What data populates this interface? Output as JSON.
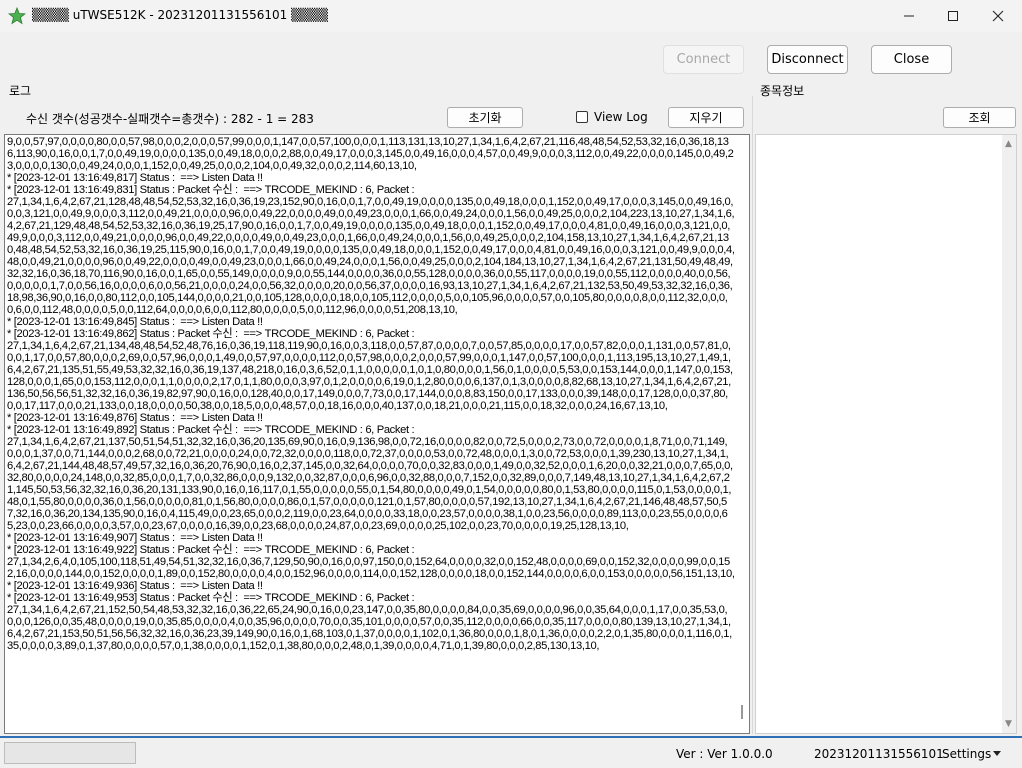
{
  "window": {
    "title": "▒▒▒▒ uTWSE512K - 20231201131556101 ▒▒▒▒",
    "minimize_icon": "minimize-icon",
    "maximize_icon": "maximize-icon",
    "close_icon": "close-icon"
  },
  "toolbar": {
    "connect_label": "Connect",
    "disconnect_label": "Disconnect",
    "close_label": "Close"
  },
  "log_panel": {
    "label": "로그",
    "count_text": "수신 갯수(성공갯수-실패갯수=총갯수) :   282 - 1 = 283",
    "reset_label": "초기화",
    "view_log_label": "View Log",
    "clear_label": "지우기",
    "content": "9,0,0,57,97,0,0,0,0,80,0,0,57,98,0,0,0,2,0,0,0,57,99,0,0,0,1,147,0,0,57,100,0,0,0,1,113,131,13,10,27,1,34,1,6,4,2,67,21,116,48,48,54,52,53,32,16,0,36,18,136,113,90,0,16,0,0,1,7,0,0,49,19,0,0,0,0,135,0,0,49,18,0,0,0,2,88,0,0,49,17,0,0,0,3,145,0,0,49,16,0,0,0,4,57,0,0,49,9,0,0,0,3,112,0,0,49,22,0,0,0,0,145,0,0,49,23,0,0,0,0,130,0,0,49,24,0,0,0,1,152,0,0,49,25,0,0,0,2,104,0,0,49,32,0,0,0,2,114,60,13,10,\n* [2023-12-01 13:16:49,817] Status :  ==> Listen Data !!\n* [2023-12-01 13:16:49,831] Status : Packet 수신 :  ==> TRCODE_MEKIND : 6, Packet :\n27,1,34,1,6,4,2,67,21,128,48,48,54,52,53,32,16,0,36,19,23,152,90,0,16,0,0,1,7,0,0,49,19,0,0,0,0,135,0,0,49,18,0,0,0,1,152,0,0,49,17,0,0,0,3,145,0,0,49,16,0,0,0,3,121,0,0,49,9,0,0,0,3,112,0,0,49,21,0,0,0,0,96,0,0,49,22,0,0,0,0,49,0,0,49,23,0,0,0,1,66,0,0,49,24,0,0,0,1,56,0,0,49,25,0,0,0,2,104,223,13,10,27,1,34,1,6,4,2,67,21,129,48,48,54,52,53,32,16,0,36,19,25,17,90,0,16,0,0,1,7,0,0,49,19,0,0,0,0,135,0,0,49,18,0,0,0,1,152,0,0,49,17,0,0,0,4,81,0,0,49,16,0,0,0,3,121,0,0,49,9,0,0,0,3,112,0,0,49,21,0,0,0,0,96,0,0,49,22,0,0,0,0,49,0,0,49,23,0,0,0,1,66,0,0,49,24,0,0,0,1,56,0,0,49,25,0,0,0,2,104,158,13,10,27,1,34,1,6,4,2,67,21,130,48,48,54,52,53,32,16,0,36,19,25,115,90,0,16,0,0,1,7,0,0,49,19,0,0,0,0,135,0,0,49,18,0,0,0,1,152,0,0,49,17,0,0,0,4,81,0,0,49,16,0,0,0,3,121,0,0,49,9,0,0,0,4,48,0,0,49,21,0,0,0,0,96,0,0,49,22,0,0,0,0,49,0,0,49,23,0,0,0,1,66,0,0,49,24,0,0,0,1,56,0,0,49,25,0,0,0,2,104,184,13,10,27,1,34,1,6,4,2,67,21,131,50,49,48,49,32,32,16,0,36,18,70,116,90,0,16,0,0,1,65,0,0,55,149,0,0,0,0,9,0,0,55,144,0,0,0,0,36,0,0,55,128,0,0,0,0,36,0,0,55,117,0,0,0,0,19,0,0,55,112,0,0,0,0,40,0,0,56,0,0,0,0,0,1,7,0,0,56,16,0,0,0,0,6,0,0,56,21,0,0,0,0,24,0,0,56,32,0,0,0,0,20,0,0,56,37,0,0,0,0,16,93,13,10,27,1,34,1,6,4,2,67,21,132,53,50,49,53,32,32,16,0,36,18,98,36,90,0,16,0,0,80,112,0,0,105,144,0,0,0,0,21,0,0,105,128,0,0,0,0,18,0,0,105,112,0,0,0,0,5,0,0,105,96,0,0,0,0,57,0,0,105,80,0,0,0,0,8,0,0,112,32,0,0,0,0,6,0,0,112,48,0,0,0,0,5,0,0,112,64,0,0,0,0,6,0,0,112,80,0,0,0,0,5,0,0,112,96,0,0,0,0,51,208,13,10,\n* [2023-12-01 13:16:49,845] Status :  ==> Listen Data !!\n* [2023-12-01 13:16:49,862] Status : Packet 수신 :  ==> TRCODE_MEKIND : 6, Packet :\n27,1,34,1,6,4,2,67,21,134,48,48,54,52,48,76,16,0,36,19,118,119,90,0,16,0,0,3,118,0,0,57,87,0,0,0,0,7,0,0,57,85,0,0,0,0,17,0,0,57,82,0,0,0,1,131,0,0,57,81,0,0,0,1,17,0,0,57,80,0,0,0,2,69,0,0,57,96,0,0,0,1,49,0,0,57,97,0,0,0,0,112,0,0,57,98,0,0,0,2,0,0,0,57,99,0,0,0,1,147,0,0,57,100,0,0,0,1,113,195,13,10,27,1,49,1,6,4,2,67,21,135,51,55,49,53,32,32,16,0,36,19,137,48,218,0,16,0,3,6,52,0,1,1,0,0,0,0,0,1,0,1,0,80,0,0,0,1,56,0,1,0,0,0,0,5,53,0,0,153,144,0,0,0,1,147,0,0,153,128,0,0,0,1,65,0,0,153,112,0,0,0,1,1,0,0,0,0,2,17,0,1,1,80,0,0,0,3,97,0,1,2,0,0,0,0,6,19,0,1,2,80,0,0,0,6,137,0,1,3,0,0,0,0,8,82,68,13,10,27,1,34,1,6,4,2,67,21,136,50,56,56,51,32,32,16,0,36,19,82,97,90,0,16,0,0,128,40,0,0,17,149,0,0,0,7,73,0,0,17,144,0,0,0,8,83,150,0,0,17,133,0,0,0,39,148,0,0,17,128,0,0,0,37,80,0,0,17,117,0,0,0,21,133,0,0,18,0,0,0,0,50,38,0,0,18,5,0,0,0,48,57,0,0,18,16,0,0,0,40,137,0,0,18,21,0,0,0,21,115,0,0,18,32,0,0,0,24,16,67,13,10,\n* [2023-12-01 13:16:49,876] Status :  ==> Listen Data !!\n* [2023-12-01 13:16:49,892] Status : Packet 수신 :  ==> TRCODE_MEKIND : 6, Packet :\n27,1,34,1,6,4,2,67,21,137,50,51,54,51,32,32,16,0,36,20,135,69,90,0,16,0,9,136,98,0,0,72,16,0,0,0,0,82,0,0,72,5,0,0,0,2,73,0,0,72,0,0,0,0,1,8,71,0,0,71,149,0,0,0,1,37,0,0,71,144,0,0,0,2,68,0,0,72,21,0,0,0,0,24,0,0,72,32,0,0,0,0,118,0,0,72,37,0,0,0,0,53,0,0,72,48,0,0,0,1,3,0,0,72,53,0,0,0,1,39,230,13,10,27,1,34,1,6,4,2,67,21,144,48,48,57,49,57,32,16,0,36,20,76,90,0,16,0,2,37,145,0,0,32,64,0,0,0,0,70,0,0,32,83,0,0,0,1,49,0,0,32,52,0,0,0,1,6,20,0,0,32,21,0,0,0,7,65,0,0,32,80,0,0,0,0,24,148,0,0,32,85,0,0,0,1,7,0,0,32,86,0,0,0,9,132,0,0,32,87,0,0,0,6,96,0,0,32,88,0,0,0,7,152,0,0,32,89,0,0,0,7,149,48,13,10,27,1,34,1,6,4,2,67,21,145,50,53,56,32,32,16,0,36,20,131,133,90,0,16,0,16,117,0,1,55,0,0,0,0,0,55,0,1,54,80,0,0,0,0,49,0,1,54,0,0,0,0,0,80,0,1,53,80,0,0,0,0,115,0,1,53,0,0,0,0,1,48,0,1,55,80,0,0,0,0,36,0,1,56,0,0,0,0,0,81,0,1,56,80,0,0,0,0,86,0,1,57,0,0,0,0,0,121,0,1,57,80,0,0,0,0,57,192,13,10,27,1,34,1,6,4,2,67,21,146,48,48,57,50,57,32,16,0,36,20,134,135,90,0,16,0,4,115,49,0,0,23,65,0,0,0,2,119,0,0,23,64,0,0,0,0,33,18,0,0,23,57,0,0,0,0,38,1,0,0,23,56,0,0,0,0,89,113,0,0,23,55,0,0,0,0,65,23,0,0,23,66,0,0,0,0,3,57,0,0,23,67,0,0,0,0,16,39,0,0,23,68,0,0,0,0,24,87,0,0,23,69,0,0,0,0,25,102,0,0,23,70,0,0,0,0,19,25,128,13,10,\n* [2023-12-01 13:16:49,907] Status :  ==> Listen Data !!\n* [2023-12-01 13:16:49,922] Status : Packet 수신 :  ==> TRCODE_MEKIND : 6, Packet :\n27,1,34,2,6,4,0,105,100,118,51,49,54,51,32,32,16,0,36,7,129,50,90,0,16,0,0,97,150,0,0,152,64,0,0,0,0,32,0,0,152,48,0,0,0,0,69,0,0,152,32,0,0,0,0,99,0,0,152,16,0,0,0,0,144,0,0,152,0,0,0,0,1,89,0,0,152,80,0,0,0,0,4,0,0,152,96,0,0,0,0,114,0,0,152,128,0,0,0,0,18,0,0,152,144,0,0,0,0,6,0,0,153,0,0,0,0,0,56,151,13,10,\n* [2023-12-01 13:16:49,936] Status :  ==> Listen Data !!\n* [2023-12-01 13:16:49,953] Status : Packet 수신 :  ==> TRCODE_MEKIND : 6, Packet :\n27,1,34,1,6,4,2,67,21,152,50,54,48,53,32,32,16,0,36,22,65,24,90,0,16,0,0,23,147,0,0,35,80,0,0,0,0,84,0,0,35,69,0,0,0,0,96,0,0,35,64,0,0,0,1,17,0,0,35,53,0,0,0,0,126,0,0,35,48,0,0,0,0,19,0,0,35,85,0,0,0,0,4,0,0,35,96,0,0,0,0,70,0,0,35,101,0,0,0,0,57,0,0,35,112,0,0,0,0,66,0,0,35,117,0,0,0,0,80,139,13,10,27,1,34,1,6,4,2,67,21,153,50,51,56,56,32,32,16,0,36,23,39,149,90,0,16,0,1,68,103,0,1,37,0,0,0,0,1,102,0,1,36,80,0,0,0,1,8,0,1,36,0,0,0,0,2,2,0,1,35,80,0,0,0,1,116,0,1,35,0,0,0,0,3,89,0,1,37,80,0,0,0,0,57,0,1,38,0,0,0,0,1,152,0,1,38,80,0,0,0,2,48,0,1,39,0,0,0,0,4,71,0,1,39,80,0,0,0,2,85,130,13,10,"
  },
  "stock_panel": {
    "label": "종목정보",
    "query_label": "조회"
  },
  "statusbar": {
    "version": "Ver : Ver 1.0.0.0",
    "session_id": "20231201131556101",
    "settings_label": "Settings"
  },
  "colors": {
    "accent": "#2f6fb5",
    "window_bg": "#f0f0f0"
  }
}
